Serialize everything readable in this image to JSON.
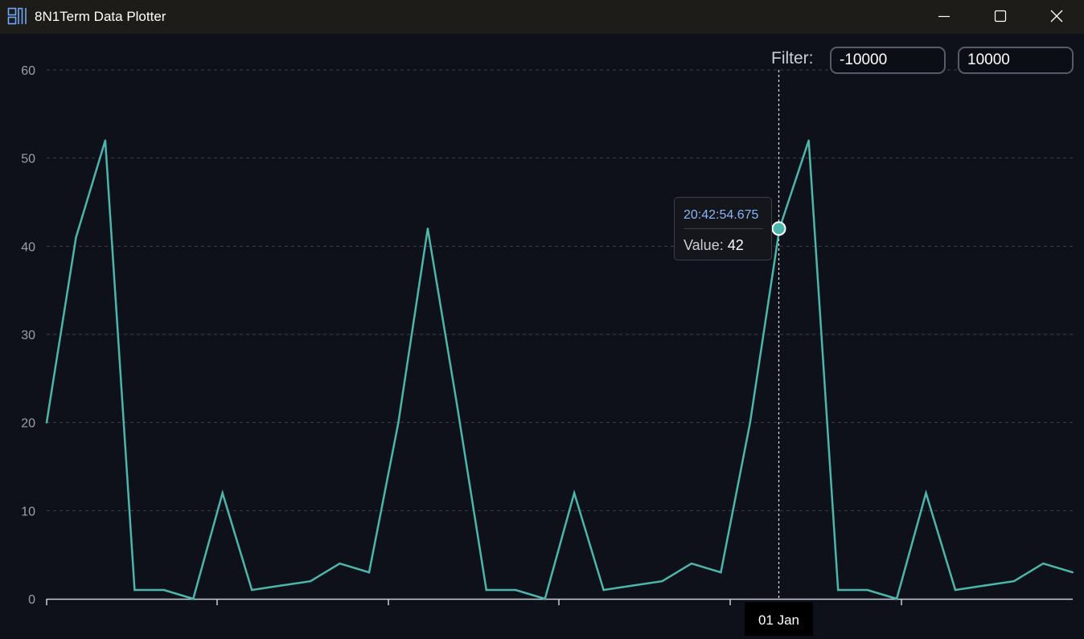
{
  "window": {
    "title": "8N1Term Data Plotter",
    "icon": "terminal-plot-icon",
    "controls": [
      "minimize-icon",
      "maximize-icon",
      "close-icon"
    ]
  },
  "filter": {
    "label": "Filter:",
    "min_value": "-10000",
    "max_value": "10000"
  },
  "tooltip": {
    "time": "20:42:54.675",
    "value_label": "Value:",
    "value": "42"
  },
  "crosshair": {
    "x_label": "01 Jan"
  },
  "colors": {
    "line": "#4db6ac",
    "grid": "#3a3f4a",
    "axis_text": "#9aa0aa",
    "titlebar": "#1d1c18",
    "background": "#0e1119",
    "tooltip_time": "#8ab4f8"
  },
  "chart_data": {
    "type": "line",
    "ylim": [
      0,
      60
    ],
    "yticks": [
      0,
      10,
      20,
      30,
      40,
      50,
      60
    ],
    "grid": true,
    "series": [
      {
        "values": [
          20,
          41,
          52,
          1,
          1,
          0,
          12,
          1,
          1.5,
          2,
          4,
          3,
          20,
          42,
          22,
          1,
          1,
          0,
          12,
          1,
          1.5,
          2,
          4,
          3,
          20,
          42,
          52,
          1,
          1,
          0,
          12,
          1,
          1.5,
          2,
          4,
          3
        ]
      }
    ],
    "highlight_index": 25
  }
}
